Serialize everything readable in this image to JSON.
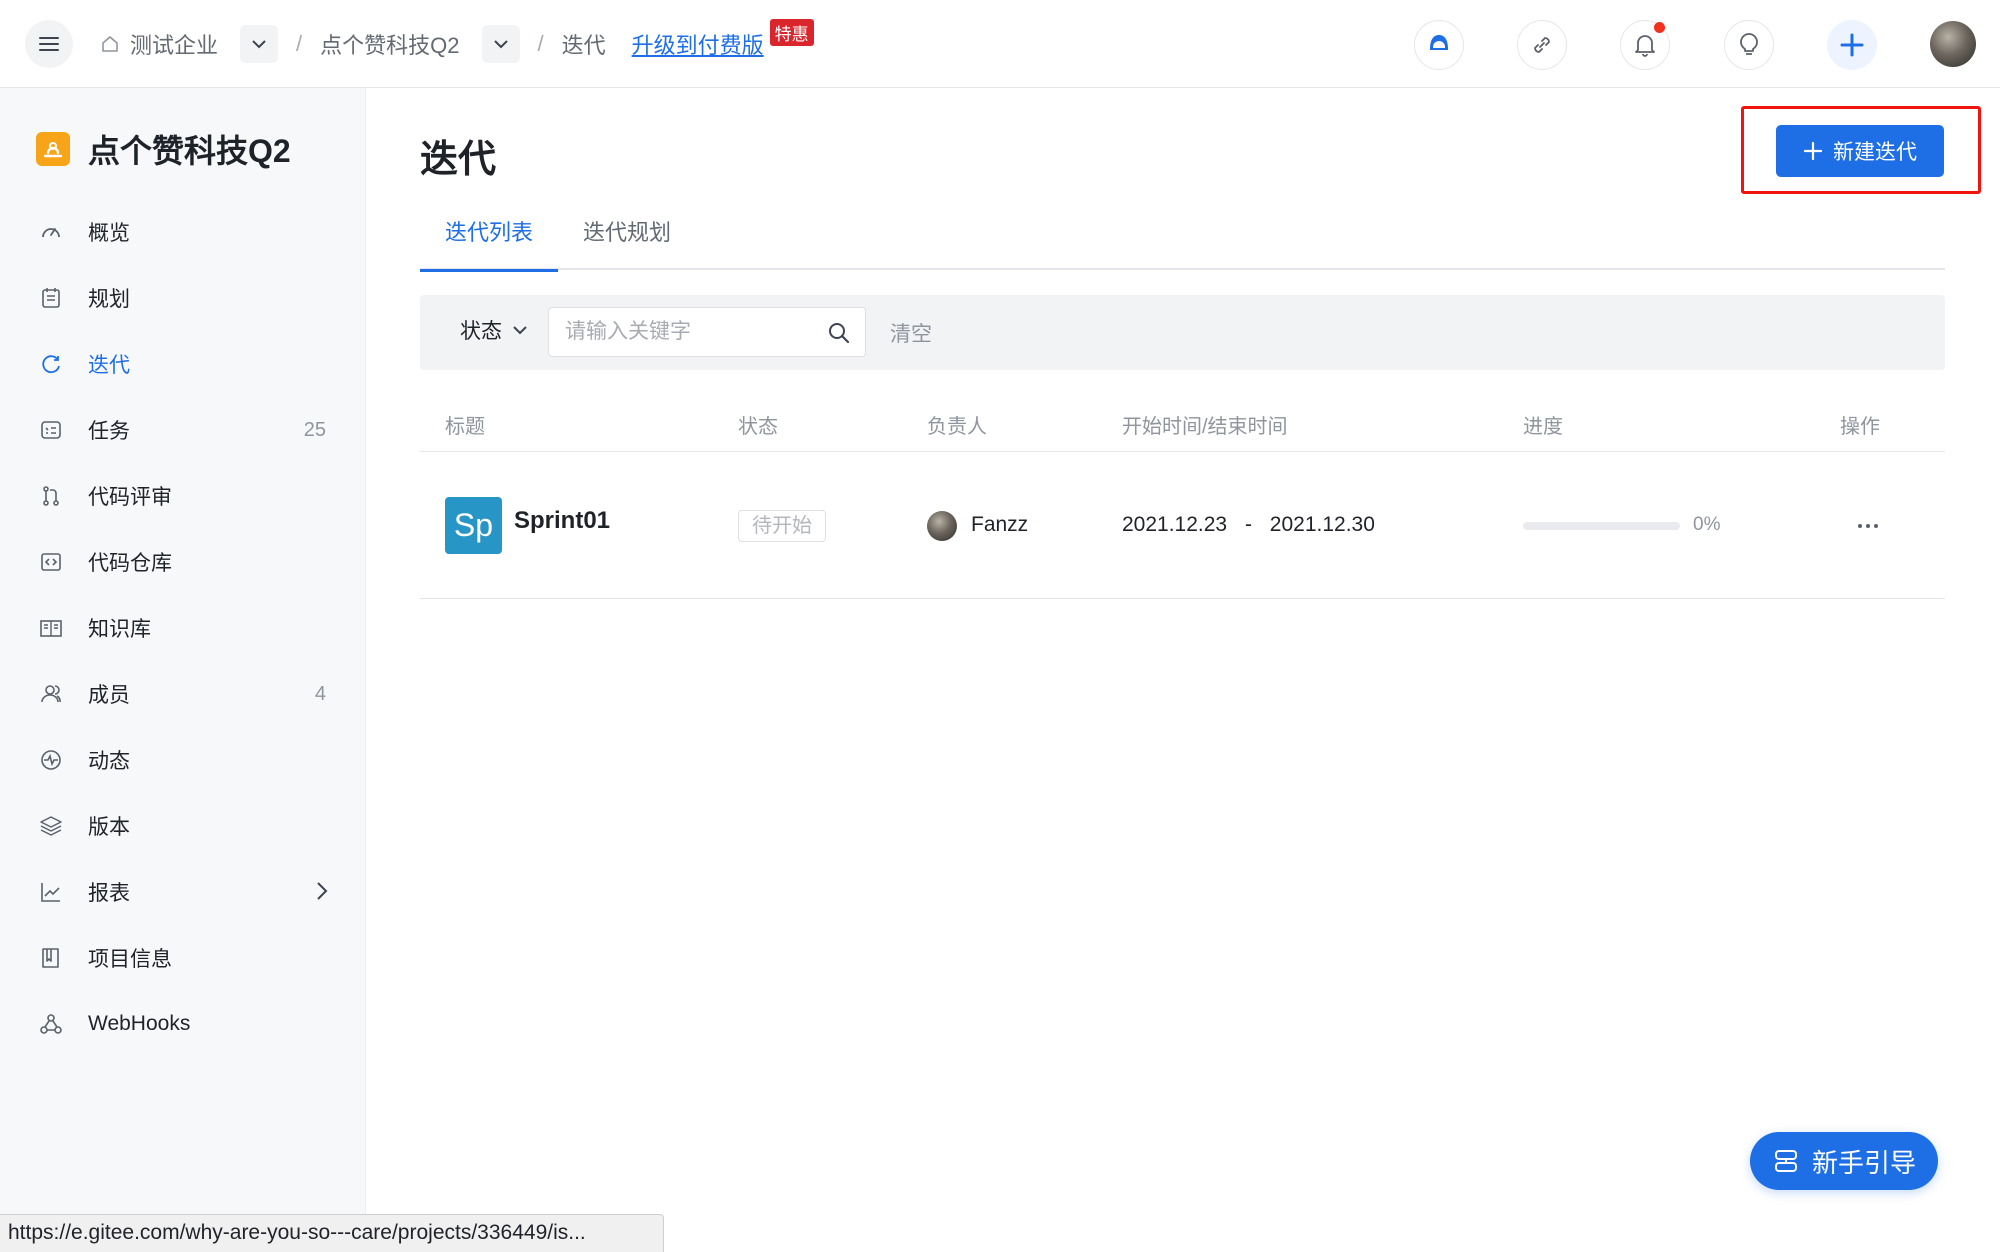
{
  "topbar": {
    "breadcrumbs": [
      "测试企业",
      "点个赞科技Q2",
      "迭代"
    ],
    "separator": "/",
    "upgrade_link": "升级到付费版",
    "upgrade_badge": "特惠",
    "icons": [
      "support-icon",
      "link-icon",
      "bell-icon",
      "lightbulb-icon",
      "plus-icon",
      "user-avatar"
    ]
  },
  "sidebar": {
    "project_name": "点个赞科技Q2",
    "items": [
      {
        "label": "概览",
        "icon": "dashboard-icon"
      },
      {
        "label": "规划",
        "icon": "calendar-icon"
      },
      {
        "label": "迭代",
        "icon": "cycle-icon",
        "active": true
      },
      {
        "label": "任务",
        "icon": "task-icon",
        "count": "25"
      },
      {
        "label": "代码评审",
        "icon": "pull-request-icon"
      },
      {
        "label": "代码仓库",
        "icon": "code-icon"
      },
      {
        "label": "知识库",
        "icon": "book-icon"
      },
      {
        "label": "成员",
        "icon": "members-icon",
        "count": "4"
      },
      {
        "label": "动态",
        "icon": "activity-icon"
      },
      {
        "label": "版本",
        "icon": "layers-icon"
      },
      {
        "label": "报表",
        "icon": "chart-icon",
        "has_arrow": true
      },
      {
        "label": "项目信息",
        "icon": "info-book-icon"
      },
      {
        "label": "WebHooks",
        "icon": "webhook-icon"
      }
    ]
  },
  "main": {
    "title": "迭代",
    "new_button": "新建迭代",
    "tabs": [
      {
        "label": "迭代列表",
        "active": true
      },
      {
        "label": "迭代规划",
        "active": false
      }
    ],
    "filter": {
      "status_label": "状态",
      "search_placeholder": "请输入关键字",
      "search_value": "",
      "clear_label": "清空"
    },
    "table": {
      "headers": [
        "标题",
        "状态",
        "负责人",
        "开始时间/结束时间",
        "进度",
        "操作"
      ],
      "rows": [
        {
          "icon_text": "Sp",
          "title": "Sprint01",
          "status": "待开始",
          "owner": "Fanzz",
          "start": "2021.12.23",
          "date_sep": "-",
          "end": "2021.12.30",
          "progress_percent": 0,
          "progress_text": "0%"
        }
      ]
    },
    "guide_button": "新手引导"
  },
  "statusbar": {
    "url": "https://e.gitee.com/why-are-you-so---care/projects/336449/is..."
  },
  "colors": {
    "accent": "#1e6fe6",
    "highlight_box": "#f0140e",
    "project_logo": "#f7a418",
    "sprint_icon": "#2796c7",
    "badge": "#d9252b"
  }
}
